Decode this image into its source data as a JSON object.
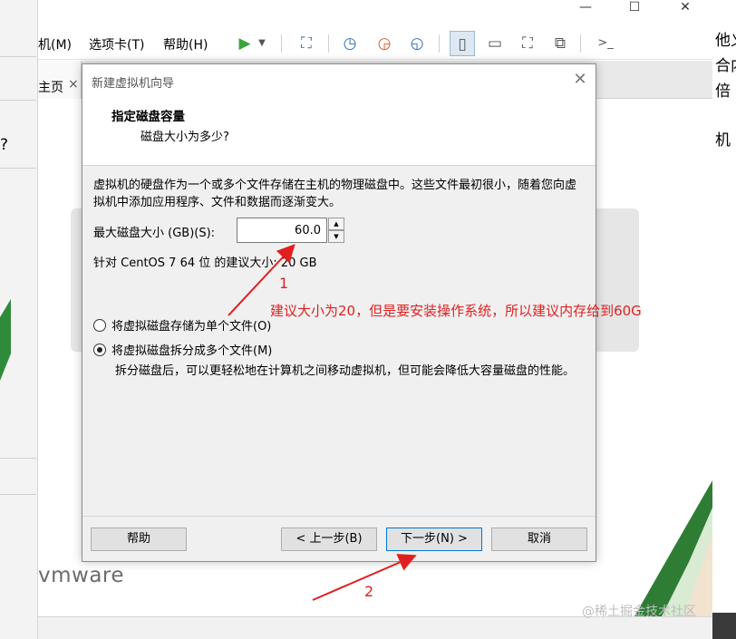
{
  "menu": {
    "vm_label": "机(M)",
    "tabs_label": "选项卡(T)",
    "help_label": "帮助(H)"
  },
  "tabstrip": {
    "home_tab_label": "主页",
    "close_glyph": "×"
  },
  "window_controls": {
    "minimize": "—",
    "maximize": "☐",
    "close": "✕"
  },
  "background": {
    "vmware_logo": "vmware",
    "right_strip_lines": [
      "他义",
      "合内",
      "倍",
      "机"
    ],
    "left_strip_glyph": "?"
  },
  "dialog": {
    "title": "新建虚拟机向导",
    "heading": "指定磁盘容量",
    "subheading": "磁盘大小为多少?",
    "description": "虚拟机的硬盘作为一个或多个文件存储在主机的物理磁盘中。这些文件最初很小，随着您向虚拟机中添加应用程序、文件和数据而逐渐变大。",
    "max_size_label": "最大磁盘大小 (GB)(S):",
    "max_size_value": "60.0",
    "recommendation": "针对 CentOS 7 64 位 的建议大小: 20 GB",
    "radio_single": {
      "label": "将虚拟磁盘存储为单个文件(O)",
      "checked": false
    },
    "radio_split": {
      "label": "将虚拟磁盘拆分成多个文件(M)",
      "checked": true
    },
    "split_note": "拆分磁盘后，可以更轻松地在计算机之间移动虚拟机，但可能会降低大容量磁盘的性能。",
    "buttons": {
      "help": "帮助",
      "back": "< 上一步(B)",
      "next": "下一步(N) >",
      "cancel": "取消"
    }
  },
  "annotations": {
    "note": "建议大小为20，但是要安装操作系统，所以建议内存给到60G",
    "marker_1": "1",
    "marker_2": "2",
    "color": "#e02020"
  },
  "watermark": "@稀土掘金技术社区"
}
